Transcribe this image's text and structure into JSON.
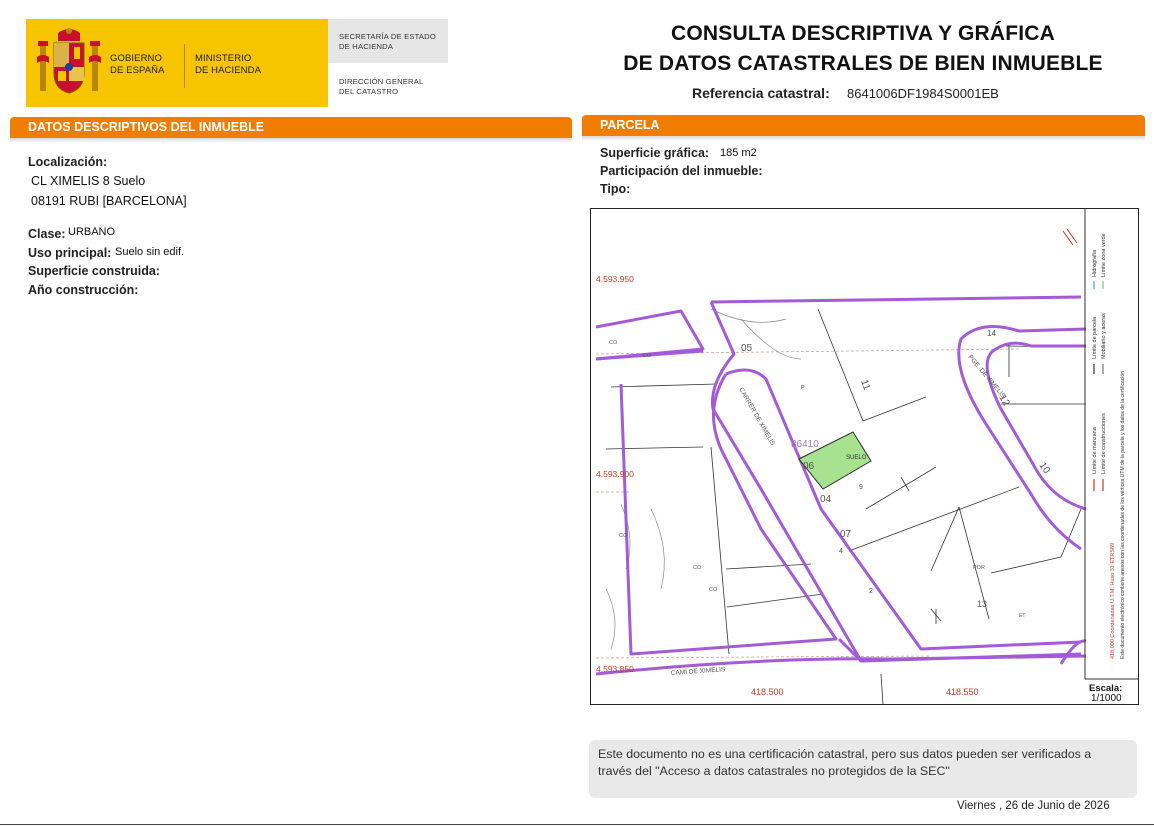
{
  "header": {
    "gobierno_line1": "GOBIERNO",
    "gobierno_line2": "DE ESPAÑA",
    "ministerio_line1": "MINISTERIO",
    "ministerio_line2": "DE HACIENDA",
    "secretaria_line1": "SECRETARÍA DE ESTADO",
    "secretaria_line2": "DE HACIENDA",
    "direccion_line1": "DIRECCIÓN GENERAL",
    "direccion_line2": "DEL CATASTRO",
    "title_line1": "CONSULTA DESCRIPTIVA Y GRÁFICA",
    "title_line2": "DE DATOS CATASTRALES DE BIEN INMUEBLE",
    "ref_label": "Referencia catastral:",
    "ref_value": "8641006DF1984S0001EB"
  },
  "left": {
    "section_title": "DATOS DESCRIPTIVOS DEL INMUEBLE",
    "localizacion_label": "Localización:",
    "address_line1": "CL XIMELIS 8 Suelo",
    "address_line2": "08191 RUBI [BARCELONA]",
    "clase_label": "Clase:",
    "clase_value": "URBANO",
    "uso_label": "Uso principal:",
    "uso_value": "Suelo sin edif.",
    "superficie_construida_label": "Superficie construida:",
    "anio_label": "Año construcción:"
  },
  "right": {
    "section_title": "PARCELA",
    "superficie_label": "Superficie gráfica:",
    "superficie_value": "185 m2",
    "participacion_label": "Participación del inmueble:",
    "tipo_label": "Tipo:"
  },
  "map": {
    "coord_y1": "4.593.950",
    "coord_y2": "4.593.900",
    "coord_y3": "4.593.850",
    "coord_x1": "418.500",
    "coord_x2": "418.550",
    "street1": "CARRER DE XIMELIS",
    "street2": "PGE. DE XIMELIS",
    "street3": "CAMÍ DE XIMELIS",
    "parcel_ref": "86410",
    "suelo_label": "SUELO",
    "lbl_co": "CO",
    "lbl_p": "P",
    "lbl_por": "POR",
    "lbl_et": "ET",
    "n05": "05",
    "n06": "06",
    "n04": "04",
    "n07": "07",
    "n11": "11",
    "n12": "12",
    "n10": "10",
    "n14": "14",
    "n9": "9",
    "n4": "4",
    "n2": "2",
    "n13": "13",
    "escala_label": "Escala:",
    "escala_value": "1/1000",
    "legend1": "Límite de manzana",
    "legend2": "Límite de parcela",
    "legend3": "Hidrografía",
    "legend4": "Límite de construcciones",
    "legend5": "Mobiliario y aceras",
    "legend6": "Límite zona verde",
    "utm_note": "418,000 Coordenadas U.T.M. Huso 31 ETRS89",
    "cert_note": "Este documento electrónico contiene anexos con las coordenadas de los vértices UTM de la parcela y los datos de la certificación"
  },
  "footer": {
    "note": "Este documento no es una certificación catastral, pero sus datos pueden ser verificados a través del \"Acceso a datos catastrales no protegidos de la SEC\"",
    "date": "Viernes , 26 de Junio de 2026"
  },
  "colors": {
    "orange": "#f07d00",
    "yellow": "#f6c500",
    "block_line": "#a35bd6",
    "parcel_fill": "#a7e28e"
  }
}
